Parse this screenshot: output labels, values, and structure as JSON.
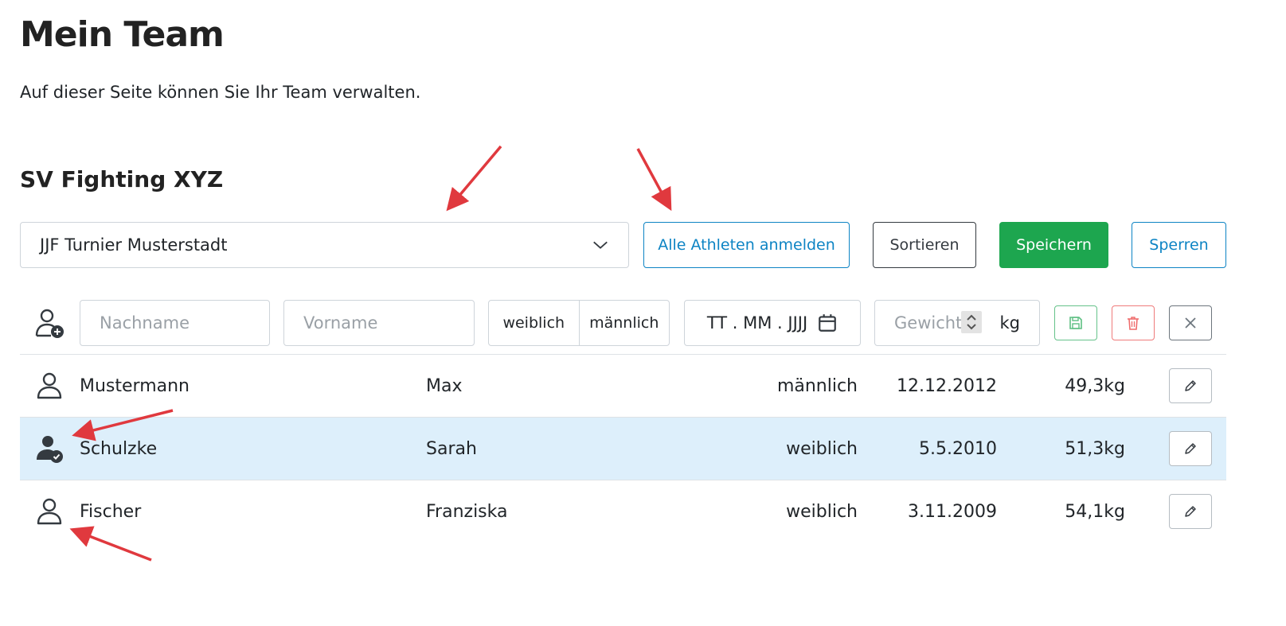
{
  "page": {
    "title": "Mein Team",
    "description": "Auf dieser Seite können Sie Ihr Team verwalten."
  },
  "team": {
    "name": "SV Fighting XYZ"
  },
  "toolbar": {
    "tournament_selected": "JJF Turnier Musterstadt",
    "register_all_label": "Alle Athleten anmelden",
    "sort_label": "Sortieren",
    "save_label": "Speichern",
    "lock_label": "Sperren"
  },
  "new_athlete": {
    "lastname_placeholder": "Nachname",
    "firstname_placeholder": "Vorname",
    "gender_female": "weiblich",
    "gender_male": "männlich",
    "date_placeholder": "TT . MM . JJJJ",
    "weight_placeholder": "Gewicht",
    "weight_unit": "kg"
  },
  "athletes": [
    {
      "lastname": "Mustermann",
      "firstname": "Max",
      "gender": "männlich",
      "birthdate": "12.12.2012",
      "weight": "49,3kg",
      "registered": false
    },
    {
      "lastname": "Schulzke",
      "firstname": "Sarah",
      "gender": "weiblich",
      "birthdate": "5.5.2010",
      "weight": "51,3kg",
      "registered": true
    },
    {
      "lastname": "Fischer",
      "firstname": "Franziska",
      "gender": "weiblich",
      "birthdate": "3.11.2009",
      "weight": "54,1kg",
      "registered": false
    }
  ],
  "colors": {
    "primary": "#0d84c4",
    "success": "#1da64f",
    "danger": "#ef7b7b",
    "row_highlight": "#ddeffb",
    "annotation_arrow": "#e0393e"
  }
}
